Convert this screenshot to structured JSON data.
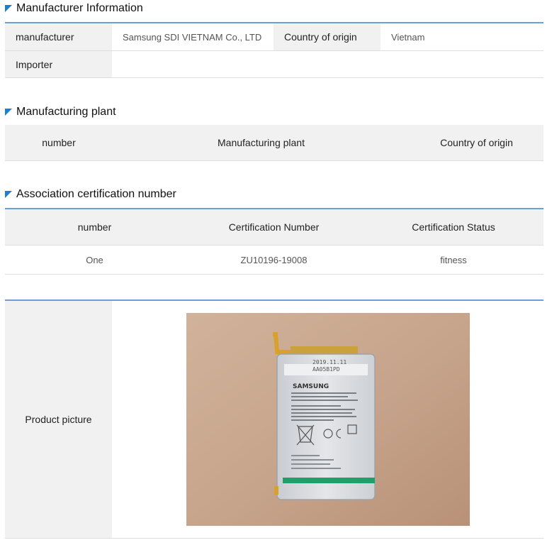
{
  "manufacturer_info": {
    "title": "Manufacturer Information",
    "manufacturer_label": "manufacturer",
    "manufacturer_value": "Samsung SDI VIETNAM Co., LTD",
    "country_label": "Country of origin",
    "country_value": "Vietnam",
    "importer_label": "Importer",
    "importer_value": ""
  },
  "manufacturing_plant": {
    "title": "Manufacturing plant",
    "columns": [
      "number",
      "Manufacturing plant",
      "Country of origin"
    ]
  },
  "certification": {
    "title": "Association certification number",
    "columns": [
      "number",
      "Certification Number",
      "Certification Status"
    ],
    "rows": [
      {
        "number": "One",
        "cert_number": "ZU10196-19008",
        "status": "fitness"
      }
    ]
  },
  "product_picture": {
    "label": "Product picture",
    "photo": {
      "brand": "SAMSUNG",
      "date_print": "2019.11.11",
      "code_print": "AA05B1PD",
      "colors": {
        "background_wood": "#c9a98f",
        "battery": "#dcdfe3",
        "stripe": "#1fa06a",
        "accent_title": "#1a7fd4"
      }
    }
  }
}
